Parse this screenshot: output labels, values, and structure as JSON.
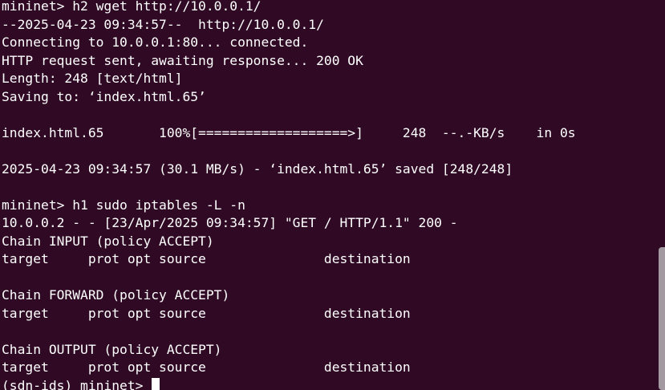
{
  "terminal": {
    "lines": [
      "mininet> h2 wget http://10.0.0.1/",
      "--2025-04-23 09:34:57--  http://10.0.0.1/",
      "Connecting to 10.0.0.1:80... connected.",
      "HTTP request sent, awaiting response... 200 OK",
      "Length: 248 [text/html]",
      "Saving to: ‘index.html.65’",
      "",
      "index.html.65       100%[===================>]     248  --.-KB/s    in 0s",
      "",
      "2025-04-23 09:34:57 (30.1 MB/s) - ‘index.html.65’ saved [248/248]",
      "",
      "mininet> h1 sudo iptables -L -n",
      "10.0.0.2 - - [23/Apr/2025 09:34:57] \"GET / HTTP/1.1\" 200 -",
      "Chain INPUT (policy ACCEPT)",
      "target     prot opt source               destination",
      "",
      "Chain FORWARD (policy ACCEPT)",
      "target     prot opt source               destination",
      "",
      "Chain OUTPUT (policy ACCEPT)",
      "target     prot opt source               destination"
    ],
    "prompt": "(sdn-ids) mininet> "
  },
  "colors": {
    "background": "#300a24",
    "foreground": "#ffffff",
    "scrollbar": "#a39aa1"
  }
}
